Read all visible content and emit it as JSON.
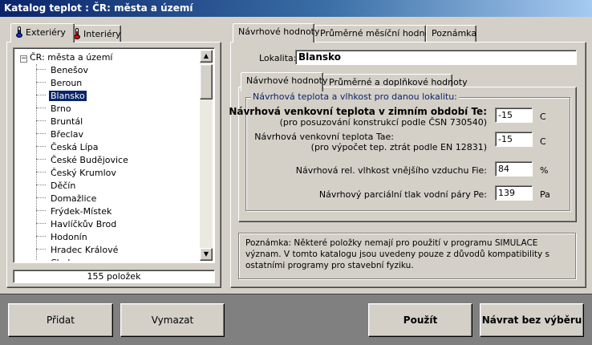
{
  "window": {
    "title": "Katalog teplot : ČR: města a území"
  },
  "left_tabs": [
    {
      "label": "Exteriéry",
      "icon": "thermometer-blue-icon",
      "color": "#1030c0"
    },
    {
      "label": "Interiéry",
      "icon": "thermometer-red-icon",
      "color": "#d01010"
    }
  ],
  "tree": {
    "root": "ČR: města a území",
    "selected": "Blansko",
    "items": [
      "Benešov",
      "Beroun",
      "Blansko",
      "Brno",
      "Bruntál",
      "Břeclav",
      "Česká Lípa",
      "České Budějovice",
      "Český Krumlov",
      "Děčín",
      "Domažlice",
      "Frýdek-Místek",
      "Havlíčkův Brod",
      "Hodonín",
      "Hradec Králové",
      "Cheb"
    ]
  },
  "count": "155 položek",
  "right_tabs": [
    "Návrhové hodnoty",
    "Průměrné měsíční hodnoty",
    "Poznámka"
  ],
  "locality": {
    "label": "Lokalita:",
    "value": "Blansko"
  },
  "inner_tabs": [
    "Návrhové hodnoty",
    "Průměrné a doplňkové hodnoty"
  ],
  "group": {
    "title": "Návrhová teplota a vlhkost pro danou lokalitu:",
    "te": {
      "label": "Návrhová venkovní teplota v zimním období Te:",
      "sub": "(pro posuzování konstrukcí podle ČSN 730540)",
      "value": "-15",
      "unit": "C"
    },
    "tae": {
      "label": "Návrhová venkovní teplota Tae:",
      "sub": "(pro výpočet tep. ztrát podle EN 12831)",
      "value": "-15",
      "unit": "C"
    },
    "fie": {
      "label": "Návrhová rel. vlhkost vnějšího vzduchu Fie:",
      "value": "84",
      "unit": "%"
    },
    "pe": {
      "label": "Návrhový parciální tlak vodní páry Pe:",
      "value": "139",
      "unit": "Pa"
    }
  },
  "note": "Poznámka: Některé položky nemají pro použití v programu SIMULACE význam. V tomto katalogu jsou uvedeny pouze z důvodů kompatibility s ostatními programy pro stavební fyziku.",
  "buttons": {
    "add": "Přidat",
    "delete": "Vymazat",
    "use": "Použít",
    "back": "Návrat bez výběru"
  }
}
